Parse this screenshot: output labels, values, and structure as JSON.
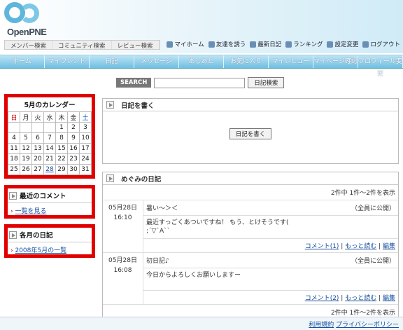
{
  "logo": {
    "text": "OpenPNE"
  },
  "toplinks": [
    "メンバー検索",
    "コミュニティ検索",
    "レビュー検索"
  ],
  "usermenu": [
    "マイホーム",
    "友達を誘う",
    "最新日記",
    "ランキング",
    "設定変更",
    "ログアウト"
  ],
  "nav": [
    "ホーム",
    "マイフレンド",
    "日記",
    "メッセージ",
    "あしあと",
    "お気に入り",
    "マイレビュー",
    "マイページ確認",
    "プロフィール変更"
  ],
  "search": {
    "button": "SEARCH",
    "value": "",
    "submit": "日記検索"
  },
  "calendar": {
    "title": "5月のカレンダー",
    "headers": [
      "日",
      "月",
      "火",
      "水",
      "木",
      "金",
      "土"
    ],
    "rows": [
      [
        "",
        "",
        "",
        "",
        "1",
        "2",
        "3"
      ],
      [
        "4",
        "5",
        "6",
        "7",
        "8",
        "9",
        "10"
      ],
      [
        "11",
        "12",
        "13",
        "14",
        "15",
        "16",
        "17"
      ],
      [
        "18",
        "19",
        "20",
        "21",
        "22",
        "23",
        "24"
      ],
      [
        "25",
        "26",
        "27",
        "28",
        "29",
        "30",
        "31"
      ]
    ]
  },
  "recent_comments": {
    "title": "最近のコメント",
    "link": "一覧を見る"
  },
  "monthly": {
    "title": "各月の日記",
    "link": "2008年5月の一覧"
  },
  "write": {
    "title": "日記を書く",
    "button": "日記を書く"
  },
  "diary": {
    "title": "めぐみの日記",
    "count_top": "2件中 1件～2件を表示",
    "count_bottom": "2件中 1件～2件を表示",
    "entries": [
      {
        "date": "05月28日",
        "time": "16:10",
        "title": "暑い～＞＜",
        "scope": "（全員に公開）",
        "text": "最近すっごくあついですね！ もう、とけそうです(\n;´▽`A``",
        "comment": "コメント(1)",
        "more": "もっと読む",
        "edit": "編集"
      },
      {
        "date": "05月28日",
        "time": "16:08",
        "title": "初日記♪",
        "scope": "（全員に公開）",
        "text": "今日からよろしくお願いしますー",
        "comment": "コメント(2)",
        "more": "もっと読む",
        "edit": "編集"
      }
    ]
  },
  "footer": {
    "terms": "利用規約",
    "privacy": "プライバシーポリシー"
  },
  "colors": {
    "sunday": "#cc0000",
    "saturday": "#0055cc",
    "highlight_border": "#e10000"
  }
}
